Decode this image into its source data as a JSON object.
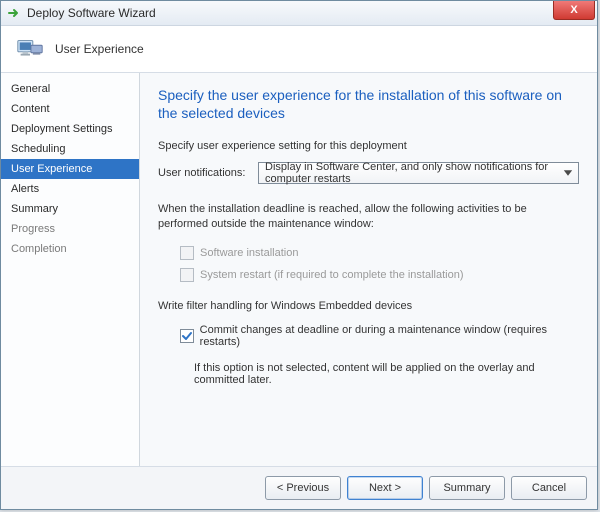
{
  "window": {
    "title": "Deploy Software Wizard",
    "close_label": "X"
  },
  "header": {
    "label": "User Experience"
  },
  "sidebar": {
    "items": [
      {
        "label": "General"
      },
      {
        "label": "Content"
      },
      {
        "label": "Deployment Settings"
      },
      {
        "label": "Scheduling"
      },
      {
        "label": "User Experience"
      },
      {
        "label": "Alerts"
      },
      {
        "label": "Summary"
      },
      {
        "label": "Progress"
      },
      {
        "label": "Completion"
      }
    ],
    "selected_index": 4
  },
  "page": {
    "title": "Specify the user experience for the installation of this software on the selected devices",
    "intro": "Specify user experience setting for this deployment",
    "notif_label": "User notifications:",
    "notif_value": "Display in Software Center, and only show notifications for computer restarts",
    "deadline_text": "When the installation deadline is reached, allow the following activities to be performed outside the maintenance window:",
    "chk_software": "Software installation",
    "chk_restart": "System restart  (if required to complete the installation)",
    "wf_heading": "Write filter handling for Windows Embedded devices",
    "chk_commit": "Commit changes at deadline or during a maintenance window (requires restarts)",
    "commit_note": "If this option is not selected, content will be applied on the overlay and committed later."
  },
  "footer": {
    "previous": "< Previous",
    "next": "Next >",
    "summary": "Summary",
    "cancel": "Cancel"
  }
}
